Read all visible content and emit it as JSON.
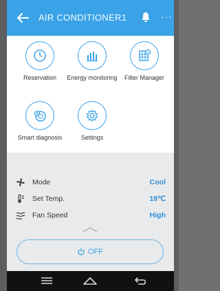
{
  "header": {
    "title": "AIR CONDITIONER1",
    "more": "···"
  },
  "tiles": [
    {
      "label": "Reservation"
    },
    {
      "label": "Energy monitoring"
    },
    {
      "label": "Filter Manager"
    },
    {
      "label": "Smart diagnosis"
    },
    {
      "label": "Settings"
    }
  ],
  "status": {
    "mode": {
      "label": "Mode",
      "value": "Cool"
    },
    "temp": {
      "label": "Set Temp.",
      "value": "18℃"
    },
    "fan": {
      "label": "Fan Speed",
      "value": "High"
    }
  },
  "power": {
    "label": "OFF"
  },
  "colors": {
    "accent": "#3aa3e8",
    "value": "#2f8fd8",
    "panel": "#e9eaeb"
  }
}
